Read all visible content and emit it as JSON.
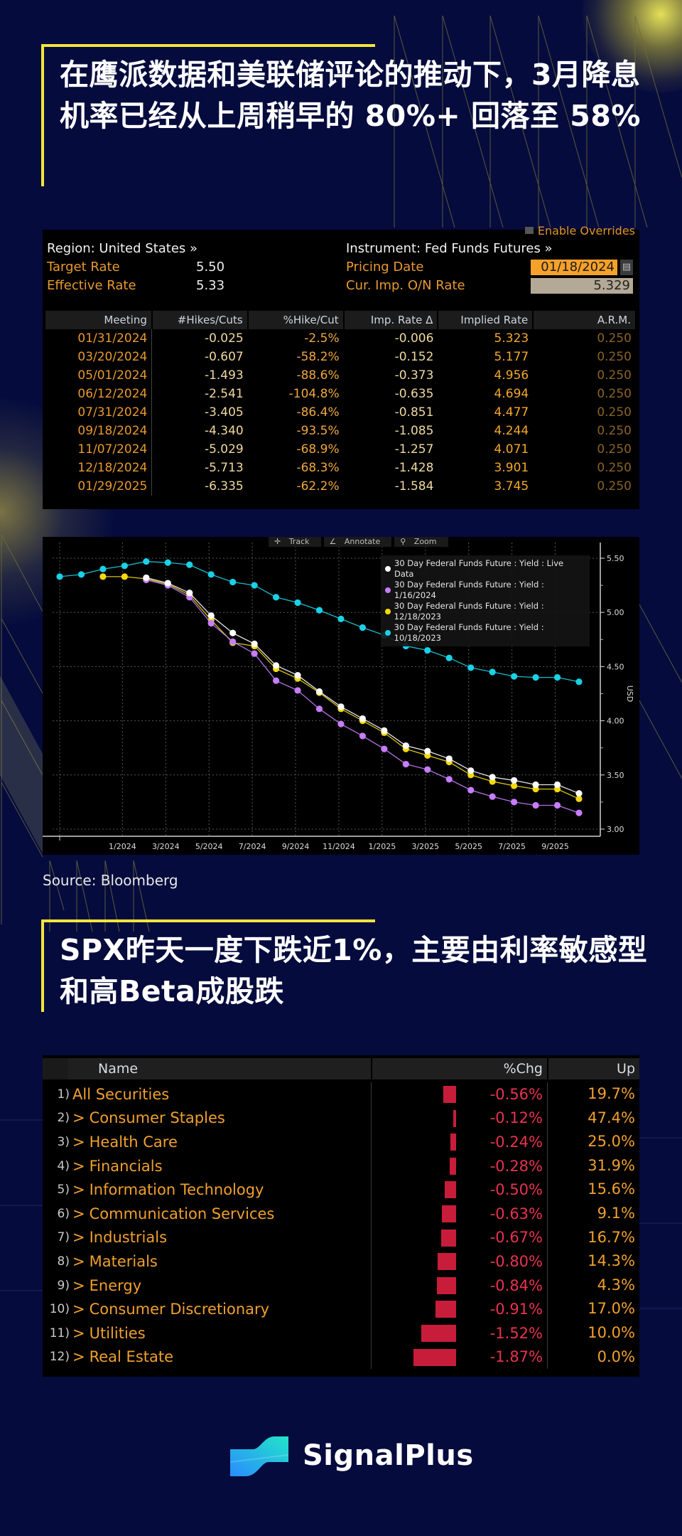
{
  "headline1": "在鹰派数据和美联储评论的推动下，3月降息机率已经从上周稍早的 80%+ 回落至 58%",
  "headline2": "SPX昨天一度下跌近1%，主要由利率敏感型和高Beta成股跌",
  "wirp": {
    "enable_overrides": "Enable Overrides",
    "region_label": "Region: United States »",
    "target_rate_label": "Target Rate",
    "target_rate_value": "5.50",
    "effective_rate_label": "Effective Rate",
    "effective_rate_value": "5.33",
    "instrument_label": "Instrument: Fed Funds Futures »",
    "pricing_date_label": "Pricing Date",
    "pricing_date_value": "01/18/2024",
    "cur_imp_label": "Cur. Imp. O/N Rate",
    "cur_imp_value": "5.329",
    "columns": [
      "Meeting",
      "#Hikes/Cuts",
      "%Hike/Cut",
      "Imp. Rate Δ",
      "Implied Rate",
      "A.R.M."
    ],
    "rows": [
      [
        "01/31/2024",
        "-0.025",
        "-2.5%",
        "-0.006",
        "5.323",
        "0.250"
      ],
      [
        "03/20/2024",
        "-0.607",
        "-58.2%",
        "-0.152",
        "5.177",
        "0.250"
      ],
      [
        "05/01/2024",
        "-1.493",
        "-88.6%",
        "-0.373",
        "4.956",
        "0.250"
      ],
      [
        "06/12/2024",
        "-2.541",
        "-104.8%",
        "-0.635",
        "4.694",
        "0.250"
      ],
      [
        "07/31/2024",
        "-3.405",
        "-86.4%",
        "-0.851",
        "4.477",
        "0.250"
      ],
      [
        "09/18/2024",
        "-4.340",
        "-93.5%",
        "-1.085",
        "4.244",
        "0.250"
      ],
      [
        "11/07/2024",
        "-5.029",
        "-68.9%",
        "-1.257",
        "4.071",
        "0.250"
      ],
      [
        "12/18/2024",
        "-5.713",
        "-68.3%",
        "-1.428",
        "3.901",
        "0.250"
      ],
      [
        "01/29/2025",
        "-6.335",
        "-62.2%",
        "-1.584",
        "3.745",
        "0.250"
      ]
    ]
  },
  "chart_toolbar": {
    "track": "Track",
    "annotate": "Annotate",
    "zoom": "Zoom"
  },
  "chart_data": {
    "type": "line",
    "title": "",
    "xlabel": "",
    "ylabel": "USD",
    "ylim": [
      3.0,
      5.55
    ],
    "yticks": [
      "5.50",
      "5.00",
      "4.50",
      "4.00",
      "3.50",
      "3.00"
    ],
    "xtick_labels": [
      "1/2024",
      "3/2024",
      "5/2024",
      "7/2024",
      "9/2024",
      "11/2024",
      "1/2025",
      "3/2025",
      "5/2025",
      "7/2025",
      "9/2025"
    ],
    "x": [
      "10/2023",
      "11/2023",
      "12/2023",
      "1/2024",
      "2/2024",
      "3/2024",
      "4/2024",
      "5/2024",
      "6/2024",
      "7/2024",
      "8/2024",
      "9/2024",
      "10/2024",
      "11/2024",
      "12/2024",
      "1/2025",
      "2/2025",
      "3/2025",
      "4/2025",
      "5/2025",
      "6/2025",
      "7/2025",
      "8/2025",
      "9/2025",
      "10/2025"
    ],
    "grid": true,
    "legend_position": "top-right",
    "series": [
      {
        "name": "30 Day Federal Funds Future : Yield : Live Data",
        "color": "#ffffff",
        "values": [
          null,
          null,
          null,
          null,
          5.32,
          5.27,
          5.18,
          4.97,
          4.81,
          4.71,
          4.51,
          4.42,
          4.27,
          4.13,
          4.02,
          3.91,
          3.77,
          3.72,
          3.65,
          3.54,
          3.48,
          3.45,
          3.41,
          3.41,
          3.33
        ]
      },
      {
        "name": "30 Day Federal Funds Future : Yield : 1/16/2024",
        "color": "#c77dff",
        "values": [
          null,
          null,
          null,
          null,
          5.3,
          5.25,
          5.14,
          4.9,
          4.73,
          4.62,
          4.37,
          4.28,
          4.11,
          3.97,
          3.86,
          3.74,
          3.6,
          3.55,
          3.46,
          3.36,
          3.3,
          3.25,
          3.22,
          3.22,
          3.15
        ]
      },
      {
        "name": "30 Day Federal Funds Future : Yield : 12/18/2023",
        "color": "#f5d90a",
        "values": [
          null,
          null,
          5.33,
          5.33,
          5.31,
          5.26,
          5.16,
          4.93,
          4.72,
          4.69,
          4.48,
          4.39,
          4.26,
          4.11,
          4.0,
          3.89,
          3.74,
          3.68,
          3.62,
          3.5,
          3.44,
          3.4,
          3.37,
          3.37,
          3.28
        ]
      },
      {
        "name": "30 Day Federal Funds Future : Yield : 10/18/2023",
        "color": "#1ad1e6",
        "values": [
          5.33,
          5.35,
          5.4,
          5.43,
          5.47,
          5.46,
          5.44,
          5.35,
          5.28,
          5.25,
          5.14,
          5.09,
          5.02,
          4.94,
          4.86,
          4.79,
          4.69,
          4.65,
          4.58,
          4.49,
          4.45,
          4.41,
          4.4,
          4.4,
          4.36
        ]
      }
    ]
  },
  "source": "Source: Bloomberg",
  "sector": {
    "columns": [
      "Name",
      "%Chg",
      "Up"
    ],
    "rows": [
      {
        "num": "1)",
        "name": "All Securities",
        "child": false,
        "chg": "-0.56%",
        "chg_value": -0.56,
        "up": "19.7%"
      },
      {
        "num": "2)",
        "name": "Consumer Staples",
        "child": true,
        "chg": "-0.12%",
        "chg_value": -0.12,
        "up": "47.4%"
      },
      {
        "num": "3)",
        "name": "Health Care",
        "child": true,
        "chg": "-0.24%",
        "chg_value": -0.24,
        "up": "25.0%"
      },
      {
        "num": "4)",
        "name": "Financials",
        "child": true,
        "chg": "-0.28%",
        "chg_value": -0.28,
        "up": "31.9%"
      },
      {
        "num": "5)",
        "name": "Information Technology",
        "child": true,
        "chg": "-0.50%",
        "chg_value": -0.5,
        "up": "15.6%"
      },
      {
        "num": "6)",
        "name": "Communication Services",
        "child": true,
        "chg": "-0.63%",
        "chg_value": -0.63,
        "up": "9.1%"
      },
      {
        "num": "7)",
        "name": "Industrials",
        "child": true,
        "chg": "-0.67%",
        "chg_value": -0.67,
        "up": "16.7%"
      },
      {
        "num": "8)",
        "name": "Materials",
        "child": true,
        "chg": "-0.80%",
        "chg_value": -0.8,
        "up": "14.3%"
      },
      {
        "num": "9)",
        "name": "Energy",
        "child": true,
        "chg": "-0.84%",
        "chg_value": -0.84,
        "up": "4.3%"
      },
      {
        "num": "10)",
        "name": "Consumer Discretionary",
        "child": true,
        "chg": "-0.91%",
        "chg_value": -0.91,
        "up": "17.0%"
      },
      {
        "num": "11)",
        "name": "Utilities",
        "child": true,
        "chg": "-1.52%",
        "chg_value": -1.52,
        "up": "10.0%"
      },
      {
        "num": "12)",
        "name": "Real Estate",
        "child": true,
        "chg": "-1.87%",
        "chg_value": -1.87,
        "up": "0.0%"
      }
    ]
  },
  "brand": {
    "name": "SignalPlus"
  }
}
